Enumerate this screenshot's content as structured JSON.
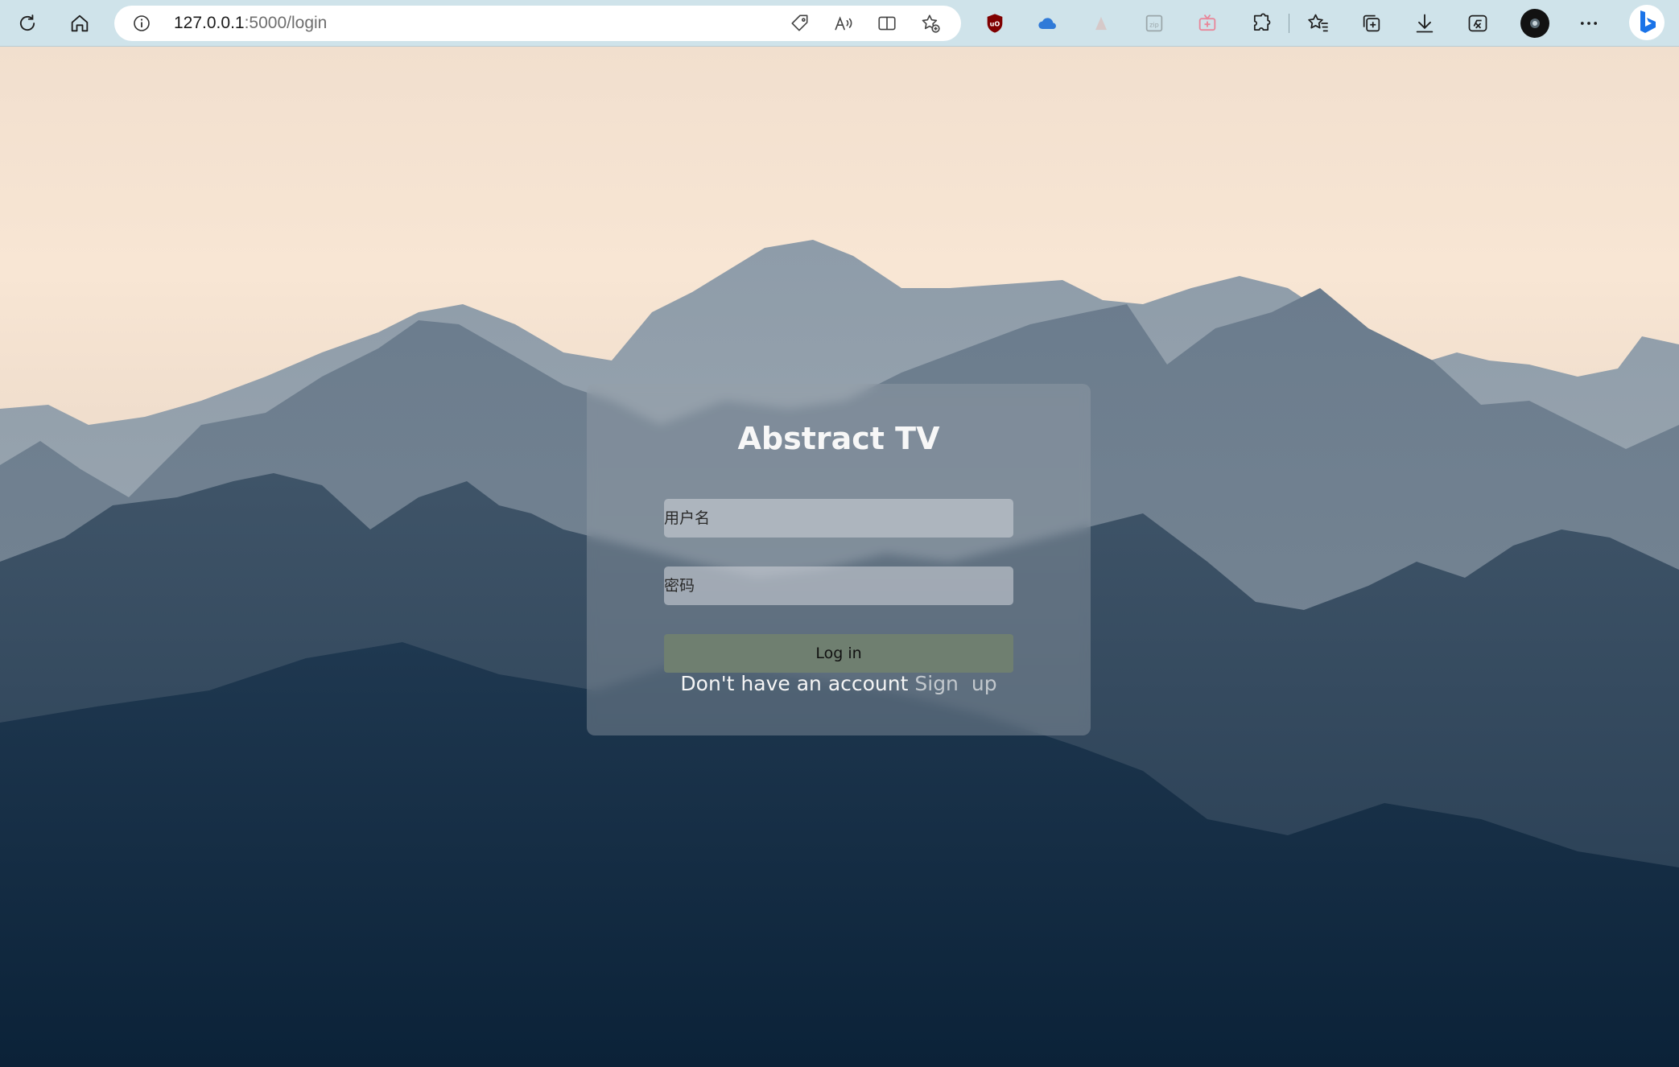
{
  "browser": {
    "url_host": "127.0.0.1",
    "url_path": ":5000/login",
    "icons": {
      "refresh": "refresh-icon",
      "home": "home-icon",
      "site_info": "info-icon",
      "tag": "tag-icon",
      "read_aloud": "read-aloud-icon",
      "split_screen": "split-screen-icon",
      "add_favorite": "add-favorite-icon",
      "extension_ublock": "ublock-icon",
      "extension_cloud": "cloud-extension-icon",
      "extension_triangle": "triangle-extension-icon",
      "extension_zip": "zip-extension-icon",
      "extension_tv": "tv-extension-icon",
      "extensions": "puzzle-icon",
      "favorites": "favorites-icon",
      "collections": "collections-icon",
      "downloads": "download-icon",
      "math_solver": "math-icon",
      "profile": "profile-avatar-icon",
      "more": "more-icon",
      "bing": "bing-icon"
    },
    "colors": {
      "toolbar": "#cfe3ea",
      "ublock_red": "#800000",
      "cloud_blue": "#2f7ad8",
      "tv_pink": "#e8879a",
      "bing_blue": "#1a73e8"
    }
  },
  "login": {
    "title": "Abstract TV",
    "username_placeholder": "用户名",
    "password_placeholder": "密码",
    "login_button": "Log in",
    "signup_prompt": "Don't have an account",
    "signup_link": "Sign up"
  }
}
